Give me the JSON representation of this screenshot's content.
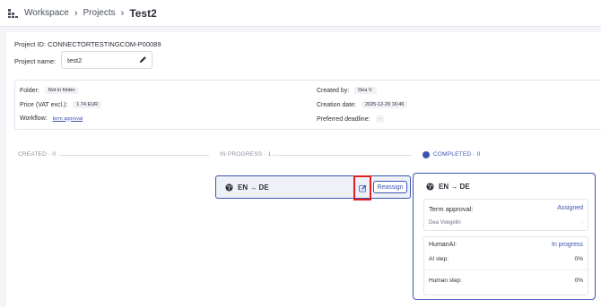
{
  "breadcrumb": {
    "workspace": "Workspace",
    "projects": "Projects",
    "current": "Test2"
  },
  "project": {
    "id_label": "Project ID:",
    "id_value": "CONNECTORTESTINGCOM-P00089",
    "name_label": "Project name:",
    "name_value": "test2"
  },
  "meta": {
    "folder_label": "Folder:",
    "folder_value": "Not in folder",
    "price_label": "Price (VAT excl.):",
    "price_value": "1.74 EUR",
    "workflow_label": "Workflow:",
    "workflow_value": "term approval",
    "created_by_label": "Created by:",
    "created_by_value": "Dea V.",
    "creation_date_label": "Creation date:",
    "creation_date_value": "2025-12-29  16:46",
    "deadline_label": "Preferred deadline:",
    "deadline_value": "-"
  },
  "stages": {
    "created": "CREATED · 0",
    "in_progress": "IN PROGRESS · 1",
    "completed": "COMPLETED · 0"
  },
  "task": {
    "lang_pair": "EN → DE",
    "reassign_label": "Reassign"
  },
  "completed_card": {
    "lang_pair": "EN → DE",
    "term_approval_label": "Term approval:",
    "term_approval_status": "Assigned",
    "assignee": "Dea Voegelin",
    "assignee_dash": "-",
    "humanai_label": "HumanAI:",
    "humanai_status": "In progress",
    "ai_step_label": "AI step:",
    "ai_step_value": "0%",
    "human_step_label": "Human step:",
    "human_step_value": "0%"
  },
  "colors": {
    "accent": "#3a55b0",
    "highlight": "#e02020"
  }
}
